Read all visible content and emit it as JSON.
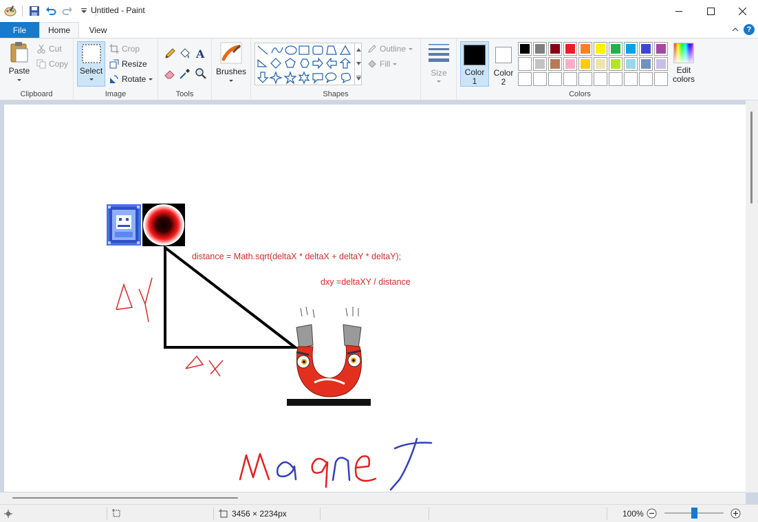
{
  "window": {
    "title": "Untitled - Paint",
    "minimize_icon": "minimize-icon",
    "maximize_icon": "maximize-icon",
    "close_icon": "close-icon"
  },
  "tabs": {
    "file": "File",
    "home": "Home",
    "view": "View"
  },
  "ribbon": {
    "clipboard": {
      "group": "Clipboard",
      "paste": "Paste",
      "cut": "Cut",
      "copy": "Copy"
    },
    "image": {
      "group": "Image",
      "select": "Select",
      "crop": "Crop",
      "resize": "Resize",
      "rotate": "Rotate"
    },
    "tools": {
      "group": "Tools"
    },
    "brushes": {
      "label": "Brushes"
    },
    "shapes": {
      "group": "Shapes",
      "outline": "Outline",
      "fill": "Fill"
    },
    "size": {
      "label": "Size"
    },
    "colors": {
      "group": "Colors",
      "color1_label": "Color",
      "color1_num": "1",
      "color2_label": "Color",
      "color2_num": "2",
      "edit_label": "Edit",
      "edit_label2": "colors",
      "color1_value": "#000000",
      "color2_value": "#ffffff",
      "palette_row1": [
        "#000000",
        "#7f7f7f",
        "#880015",
        "#ed1c24",
        "#ff7f27",
        "#fff200",
        "#22b14c",
        "#00a2e8",
        "#3f48cc",
        "#a349a4"
      ],
      "palette_row2": [
        "#ffffff",
        "#c3c3c3",
        "#b97a57",
        "#ffaec9",
        "#ffc90e",
        "#efe4b0",
        "#b5e61d",
        "#99d9ea",
        "#7092be",
        "#c8bfe7"
      ]
    }
  },
  "canvas": {
    "formula1": "distance = Math.sqrt(deltaX * deltaX + deltaY * deltaY);",
    "formula2": "dxy =deltaXY / distance",
    "handwriting": [
      "ΔY",
      "ΔX",
      "MagneT"
    ]
  },
  "status": {
    "dimensions": "3456 × 2234px",
    "zoom": "100%"
  }
}
